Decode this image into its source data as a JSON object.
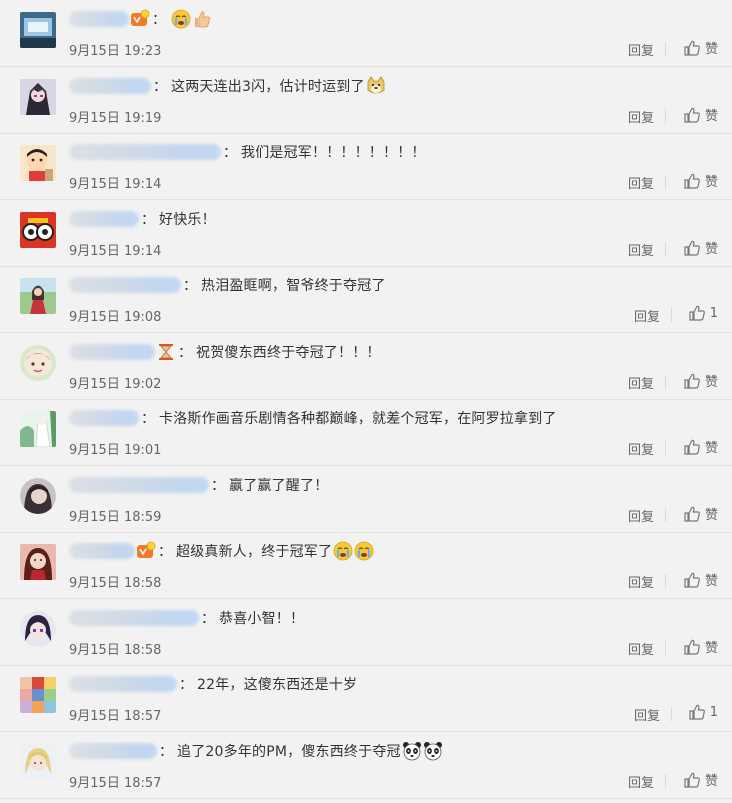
{
  "comments": [
    {
      "name_width": 60,
      "badge": "vip",
      "text": "",
      "emojis": [
        "cry",
        "thumb"
      ],
      "time": "9月15日 19:23",
      "reply": "回复",
      "like": "赞",
      "avatar": "blue-window"
    },
    {
      "name_width": 82,
      "badge": "",
      "text": "这两天连出3闪，估计时运到了",
      "emojis": [
        "doge"
      ],
      "time": "9月15日 19:19",
      "reply": "回复",
      "like": "赞",
      "avatar": "dark-anime"
    },
    {
      "name_width": 152,
      "badge": "",
      "text": "我们是冠军！！！！！！！！",
      "emojis": [],
      "time": "9月15日 19:14",
      "reply": "回复",
      "like": "赞",
      "avatar": "shinchan"
    },
    {
      "name_width": 70,
      "badge": "",
      "text": "好快乐！",
      "emojis": [],
      "time": "9月15日 19:14",
      "reply": "回复",
      "like": "赞",
      "avatar": "pokeball-face"
    },
    {
      "name_width": 112,
      "badge": "",
      "text": "热泪盈眶啊，智爷终于夺冠了",
      "emojis": [],
      "time": "9月15日 19:08",
      "reply": "回复",
      "like": "1",
      "avatar": "girl-red"
    },
    {
      "name_width": 86,
      "badge": "hourglass",
      "text": "祝贺傻东西终于夺冠了！！！",
      "emojis": [],
      "time": "9月15日 19:02",
      "reply": "回复",
      "like": "赞",
      "avatar": "round-boy"
    },
    {
      "name_width": 70,
      "badge": "",
      "text": "卡洛斯作画音乐剧情各种都巅峰，就差个冠军，在阿罗拉拿到了",
      "emojis": [],
      "time": "9月15日 19:01",
      "reply": "回复",
      "like": "赞",
      "avatar": "white-green"
    },
    {
      "name_width": 140,
      "badge": "",
      "text": "赢了赢了醒了！",
      "emojis": [],
      "time": "9月15日 18:59",
      "reply": "回复",
      "like": "赞",
      "avatar": "dark-girl"
    },
    {
      "name_width": 66,
      "badge": "vip",
      "text": "超级真新人，终于冠军了",
      "emojis": [
        "cry",
        "cry"
      ],
      "time": "9月15日 18:58",
      "reply": "回复",
      "like": "赞",
      "avatar": "red-girl"
    },
    {
      "name_width": 130,
      "badge": "",
      "text": "恭喜小智！！",
      "emojis": [],
      "time": "9月15日 18:58",
      "reply": "回复",
      "like": "赞",
      "avatar": "purple-anime"
    },
    {
      "name_width": 108,
      "badge": "",
      "text": "22年，这傻东西还是十岁",
      "emojis": [],
      "time": "9月15日 18:57",
      "reply": "回复",
      "like": "1",
      "avatar": "collage"
    },
    {
      "name_width": 88,
      "badge": "",
      "text": "追了20多年的PM，傻东西终于夺冠",
      "emojis": [
        "panda",
        "panda"
      ],
      "time": "9月15日 18:57",
      "reply": "回复",
      "like": "赞",
      "avatar": "blonde"
    }
  ],
  "colors": {
    "background": "#f2f2f2",
    "text": "#333333",
    "meta": "#666666",
    "divider": "#e2e2e2"
  }
}
